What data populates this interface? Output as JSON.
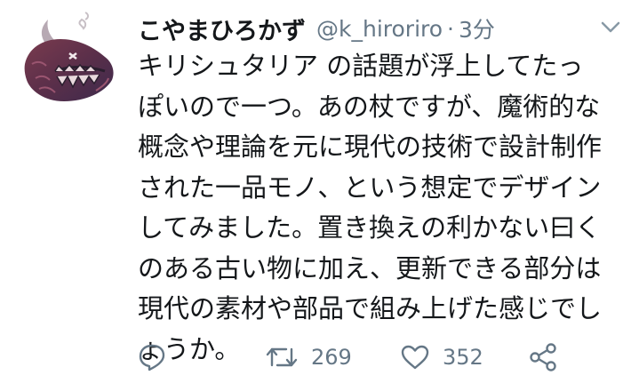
{
  "tweet": {
    "display_name": "こやまひろかず",
    "handle": "@k_hiroriro",
    "separator": "·",
    "time": "3分",
    "body_lines": [
      "キリシュタリア の話題が浮上してたっ",
      "ぽいので一つ。あの杖ですが、魔術的な",
      "概念や理論を元に現代の技術で設計制作",
      "された一品モノ、という想定でデザイン",
      "してみました。置き換えの利かない曰く",
      "のある古い物に加え、更新できる部分は",
      "現代の素材や部品で組み上げた感じでし",
      "ょうか。"
    ],
    "actions": {
      "reply_icon": "reply-icon",
      "retweet_icon": "retweet-icon",
      "retweet_count": "269",
      "like_icon": "heart-icon",
      "like_count": "352",
      "share_icon": "share-icon"
    }
  },
  "colors": {
    "text": "#14171a",
    "secondary": "#657786",
    "background": "#ffffff"
  }
}
